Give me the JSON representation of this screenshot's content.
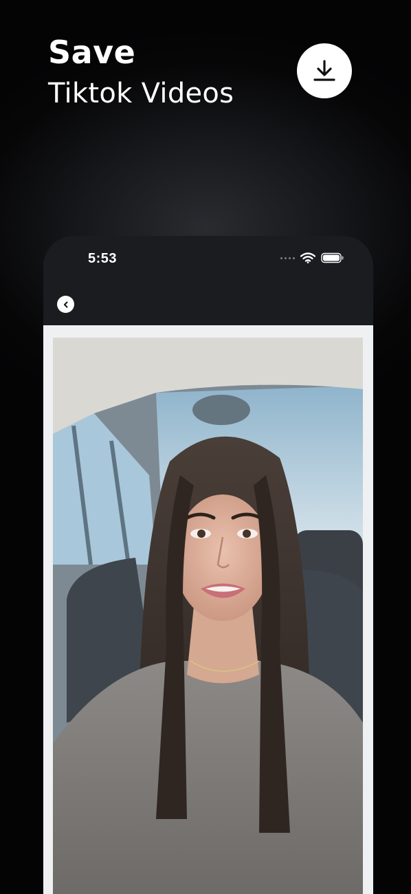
{
  "header": {
    "title": "Save",
    "subtitle": "Tiktok Videos"
  },
  "actions": {
    "download_icon": "download-icon"
  },
  "phone": {
    "status_bar": {
      "time": "5:53",
      "icons": [
        "signal-dots-icon",
        "wifi-icon",
        "battery-icon"
      ]
    },
    "nav": {
      "back_icon": "chevron-left-icon"
    },
    "video": {
      "description": "video-preview"
    }
  },
  "colors": {
    "background": "#050506",
    "accent": "#ffffff",
    "frame": "#eef0f2"
  }
}
